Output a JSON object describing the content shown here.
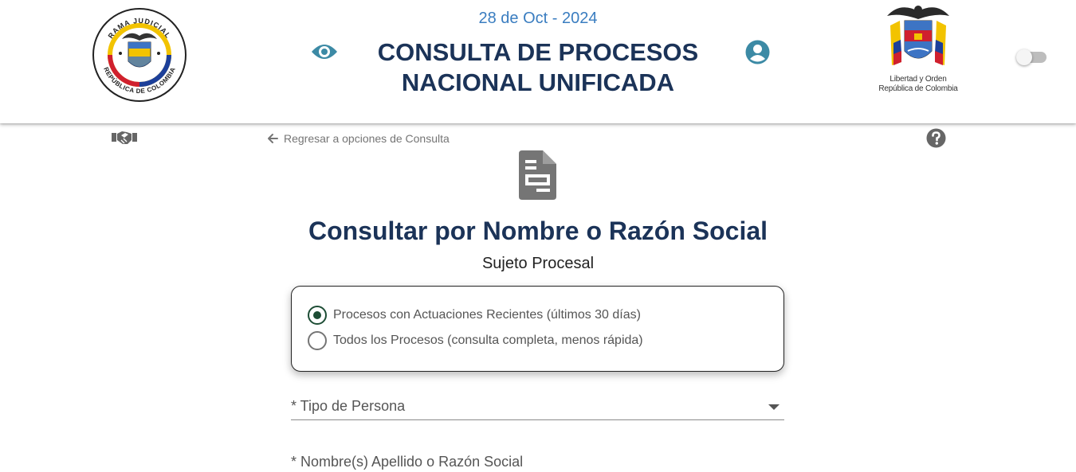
{
  "header": {
    "date": "28 de Oct - 2024",
    "title_line1": "CONSULTA DE PROCESOS",
    "title_line2": "NACIONAL UNIFICADA",
    "logo_left_text_top": "RAMA JUDICIAL",
    "logo_left_text_bottom": "REPÚBLICA DE COLOMBIA",
    "logo_right_caption_line1": "Libertad y Orden",
    "logo_right_caption_line2": "República de Colombia",
    "toggle_state": "off"
  },
  "icons": {
    "eye": "eye-icon",
    "user": "account-circle-icon",
    "handshake": "handshake-icon",
    "back": "arrow-left-icon",
    "help": "help-circle-icon",
    "document": "file-document-icon"
  },
  "nav": {
    "back_label": "Regresar a opciones de Consulta"
  },
  "main": {
    "title": "Consultar por Nombre o Razón Social",
    "subtitle": "Sujeto Procesal",
    "radio_options": [
      {
        "label": "Procesos con Actuaciones Recientes (últimos 30 días)",
        "checked": true
      },
      {
        "label": "Todos los Procesos (consulta completa, menos rápida)",
        "checked": false
      }
    ],
    "tipo_persona_label": "* Tipo de Persona",
    "nombre_label": "* Nombre(s) Apellido o Razón Social"
  },
  "colors": {
    "title": "#1b3358",
    "date": "#3a7dc0",
    "icon_accent": "#3c8aa5",
    "radio_checked": "#1d4d35",
    "gray_icon": "#666666"
  }
}
